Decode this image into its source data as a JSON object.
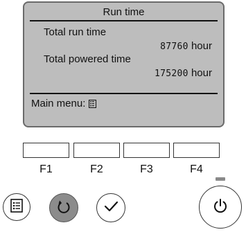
{
  "screen": {
    "title": "Run time",
    "rows": [
      {
        "label": "Total run time",
        "value": "87760",
        "unit": "hour"
      },
      {
        "label": "Total powered time",
        "value": "175200",
        "unit": "hour"
      }
    ],
    "menu_label": "Main menu:",
    "menu_icon": "menu-icon"
  },
  "function_keys": [
    "F1",
    "F2",
    "F3",
    "F4"
  ],
  "buttons": {
    "menu": "menu-icon",
    "return": "return-icon",
    "select": "check-icon",
    "power": "power-icon"
  },
  "colors": {
    "lcd_background": "#bdbdbd",
    "lcd_border": "#6a6a6a",
    "return_button": "#8c8c8c",
    "led": "#8a8a8a"
  }
}
